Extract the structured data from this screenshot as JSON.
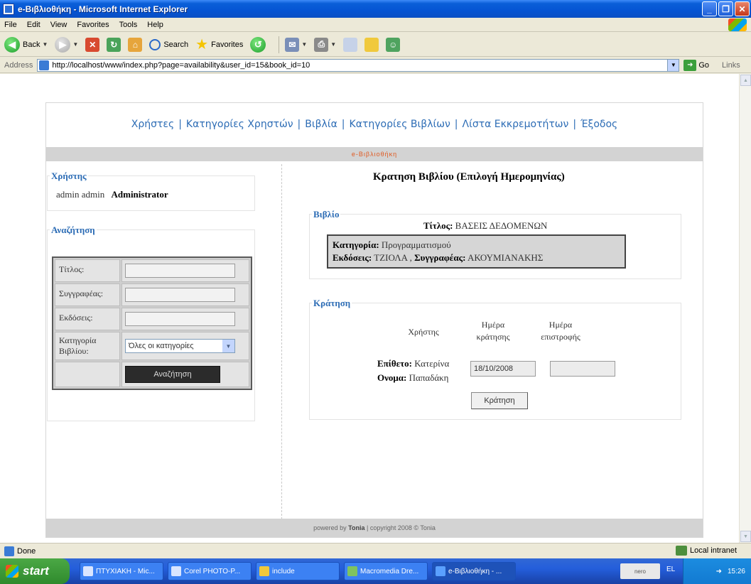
{
  "window": {
    "title": "e-Βιβλιοθήκη - Microsoft Internet Explorer"
  },
  "menu": [
    "File",
    "Edit",
    "View",
    "Favorites",
    "Tools",
    "Help"
  ],
  "toolbar": {
    "back_label": "Back",
    "search_label": "Search",
    "favorites_label": "Favorites"
  },
  "address": {
    "label": "Address",
    "url": "http://localhost/www/index.php?page=availability&user_id=15&book_id=10",
    "go_label": "Go",
    "links_label": "Links"
  },
  "site": {
    "nav": [
      "Χρήστες",
      "Κατηγορίες Χρηστών",
      "Βιβλία",
      "Κατηγορίες Βιβλίων",
      "Λίστα Εκκρεμοτήτων",
      "Έξοδος"
    ],
    "band_title": "e-Βιβλιοθήκη",
    "user_box": {
      "legend": "Χρήστης",
      "name": "admin admin",
      "role": "Administrator"
    },
    "search_box": {
      "legend": "Αναζήτηση",
      "title_label": "Τίτλος:",
      "author_label": "Συγγραφέας:",
      "publisher_label": "Εκδόσεις:",
      "category_label": "Κατηγορία Βιβλίου:",
      "category_selected": "Όλες οι κατηγορίες",
      "button": "Αναζήτηση"
    },
    "reservation_title": "Κρατηση Βιβλίου (Επιλογή Ημερομηνίας)",
    "book_box": {
      "legend": "Βιβλίο",
      "title_label": "Τίτλος:",
      "title_value": "ΒΑΣΕΙΣ ΔΕΔΟΜΕΝΩΝ",
      "category_label": "Κατηγορία:",
      "category_value": "Προγραμματισμού",
      "publisher_label": "Εκδόσεις:",
      "publisher_value": "ΤΖΙΟΛΑ ,",
      "author_label": "Συγγραφέας:",
      "author_value": "ΑΚΟΥΜΙΑΝΑΚΗΣ"
    },
    "reserve_box": {
      "legend": "Κράτηση",
      "col_user": "Χρήστης",
      "col_reserve_date": "Ημέρα κράτησης",
      "col_return_date": "Ημέρα επιστροφής",
      "surname_label": "Επίθετο:",
      "surname_value": "Κατερίνα",
      "name_label": "Ονομα:",
      "name_value": "Παπαδάκη",
      "reserve_date": "18/10/2008",
      "return_date": "",
      "button": "Κράτηση"
    },
    "footer": {
      "powered_by": "powered by",
      "author": "Tonia",
      "copyright": "| copyright 2008 © Tonia"
    }
  },
  "status": {
    "text": "Done",
    "zone": "Local intranet"
  },
  "taskbar": {
    "start": "start",
    "tasks": [
      "ΠΤΥΧΙΑΚΗ - Mic...",
      "Corel PHOTO-P...",
      "include",
      "Macromedia Dre...",
      "e-Βιβλιοθήκη - ..."
    ],
    "lang": "EL",
    "nero": "nero",
    "clock": "15:26"
  }
}
